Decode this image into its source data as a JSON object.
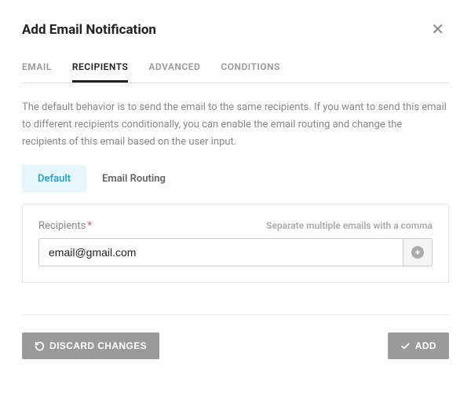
{
  "header": {
    "title": "Add Email Notification"
  },
  "tabs": {
    "email": "EMAIL",
    "recipients": "RECIPIENTS",
    "advanced": "ADVANCED",
    "conditions": "CONDITIONS"
  },
  "body": {
    "description": "The default behavior is to send the email to the same recipients. If you want to send this email to different recipients conditionally, you can enable the email routing and change the recipients of this email based on the user input.",
    "subtabs": {
      "default": "Default",
      "routing": "Email Routing"
    },
    "recipients": {
      "label": "Recipients",
      "required_mark": "*",
      "hint": "Separate multiple emails with a comma",
      "value": "email@gmail.com"
    }
  },
  "footer": {
    "discard": "DISCARD CHANGES",
    "add": "ADD"
  }
}
